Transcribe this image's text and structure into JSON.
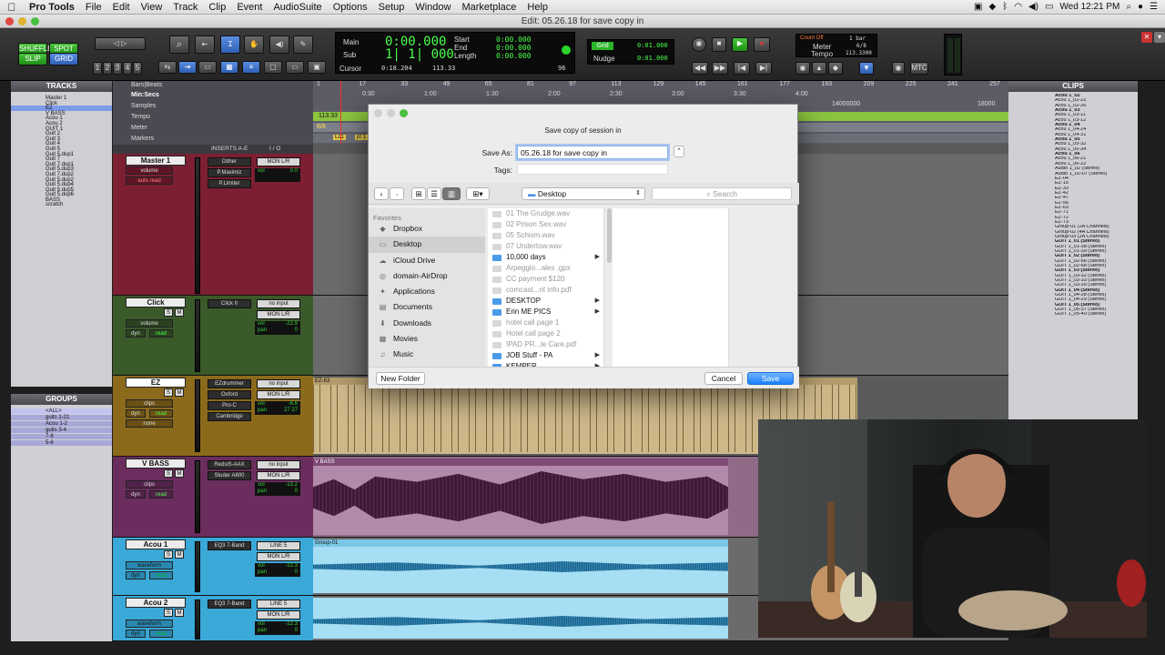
{
  "menubar": {
    "app": "Pro Tools",
    "items": [
      "File",
      "Edit",
      "View",
      "Track",
      "Clip",
      "Event",
      "AudioSuite",
      "Options",
      "Setup",
      "Window",
      "Marketplace",
      "Help"
    ],
    "clock": "Wed 12:21 PM"
  },
  "window": {
    "title": "Edit: 05.26.18 for save copy in"
  },
  "toolbar": {
    "shuffle": "SHUFFLE",
    "spot": "SPOT",
    "slip": "SLIP",
    "grid": "GRID",
    "zoom_presets": [
      "1",
      "2",
      "3",
      "4",
      "5"
    ],
    "counter": {
      "main_label": "Main",
      "main_value": "0:00.000",
      "sub_label": "Sub",
      "sub_value": "1| 1| 000",
      "start_label": "Start",
      "start_value": "0:00.000",
      "end_label": "End",
      "end_value": "0:00.000",
      "length_label": "Length",
      "length_value": "0:00.000",
      "cursor_label": "Cursor",
      "cursor_value": "0:18.204",
      "cursor_tempo": "113.33",
      "cursor_bar": "96"
    },
    "grid_label": "Grid",
    "grid_value": "0:01.000",
    "nudge_label": "Nudge",
    "nudge_value": "0:01.000",
    "count_off": "Count Off",
    "count_off_value": "1 bar",
    "meter_label": "Meter",
    "meter_value": "6/8",
    "tempo_label": "Tempo",
    "tempo_value": "113.3300",
    "mtc": "MTC"
  },
  "tracks_panel": {
    "title": "TRACKS",
    "items": [
      "Master 1",
      "Click",
      "EZ",
      "V BASS",
      "Acou 1",
      "Acou 2",
      "GUIT 1",
      "Guit 2",
      "Guit 3",
      "Guit 4",
      "Guit 5",
      "Guit 5.dup1",
      "Guit 7",
      "Guit 7.dup1",
      "Guit 5.dup3",
      "Guit 7.dup2",
      "Guit 5.dup2",
      "Guit 5.dup4",
      "Guit 5.dup5",
      "Guit 5.dup6",
      "BASS",
      "scratch"
    ]
  },
  "groups_panel": {
    "title": "GROUPS",
    "items": [
      "<ALL>",
      "guits 1-21",
      "Acou 1-2",
      "guits 3-4",
      "7-8",
      "5-6"
    ]
  },
  "rulers": {
    "labels": [
      "Bars|Beats",
      "Min:Secs",
      "Samples",
      "Tempo",
      "Meter",
      "Markers"
    ],
    "bars": [
      "1",
      "17",
      "33",
      "49",
      "65",
      "81",
      "97",
      "113",
      "129",
      "145",
      "161",
      "177",
      "193",
      "209",
      "225",
      "241",
      "257"
    ],
    "mins": [
      "0:30",
      "1:00",
      "1:30",
      "2:00",
      "2:30",
      "3:00",
      "3:30",
      "4:00"
    ],
    "samples": [
      "14000000",
      "18000"
    ],
    "tempo_value": "113.33",
    "meter_value": "6/8",
    "marker_labels": [
      "Lo1",
      "pt 1"
    ]
  },
  "edit_window": {
    "inserts_header": "INSERTS A-E",
    "io_header": "I / O",
    "tracks": [
      {
        "name": "Master 1",
        "view": "volume",
        "automation": "auto read",
        "inserts": [
          "Dither",
          "P.Maximiz",
          "P.Limiter"
        ],
        "io_out": "MON L/R",
        "vol_label": "vol",
        "vol_value": "0.0"
      },
      {
        "name": "Click",
        "view": "volume",
        "automation": "read",
        "mode": "dyn",
        "inserts": [
          "Click II"
        ],
        "io_in": "no input",
        "io_out": "MON L/R",
        "vol_label": "vol",
        "vol_value": "-22.9",
        "pan_label": "pan",
        "pan_value": "0"
      },
      {
        "name": "EZ",
        "view": "clips",
        "automation": "read",
        "mode": "dyn",
        "extra": "none",
        "inserts": [
          "EZdrummer",
          "Oxford",
          "Pro-C",
          "Cambridge"
        ],
        "io_in": "no input",
        "io_out": "MON L/R",
        "vol_label": "vol",
        "vol_value": "-6.6",
        "pan_label": "pan",
        "pan_value": "27 27",
        "clip": "EZ-63"
      },
      {
        "name": "V BASS",
        "view": "clips",
        "automation": "read",
        "mode": "dyn",
        "inserts": [
          "RedsiS-AAX",
          "Studer A800"
        ],
        "io_in": "no input",
        "io_out": "MON L/R",
        "vol_label": "vol",
        "vol_value": "-13.2",
        "pan_label": "pan",
        "pan_value": "0",
        "clip": "V BASS"
      },
      {
        "name": "Acou 1",
        "view": "waveform",
        "automation": "read",
        "mode": "dyn",
        "inserts": [
          "EQ3 7-Band"
        ],
        "io_in": "LINE 5",
        "io_out": "MON L/R",
        "vol_label": "vol",
        "vol_value": "-12.3",
        "pan_label": "pan",
        "pan_value": "0",
        "clip": "Group-01"
      },
      {
        "name": "Acou 2",
        "view": "waveform",
        "automation": "read",
        "mode": "dyn",
        "inserts": [
          "EQ3 7-Band"
        ],
        "io_in": "LINE 5",
        "io_out": "MON L/R",
        "vol_label": "vol",
        "vol_value": "-12.3",
        "pan_label": "pan",
        "pan_value": "0"
      }
    ],
    "track_buttons": {
      "solo": "S",
      "mute": "M"
    }
  },
  "clips_panel": {
    "title": "CLIPS",
    "items": [
      "Acou 1_02",
      "Acou 1_02-22",
      "Acou 1_02-26",
      "Acou 1_03",
      "Acou 1_03-11",
      "Acou 1_03-12",
      "Acou 1_04",
      "Acou 1_04-24",
      "Acou 1_04-31",
      "Acou 1_05",
      "Acou 1_05-32",
      "Acou 1_05-34",
      "Acou 1_06",
      "Acou 1_06-21",
      "Acou 1_06-22",
      "Audio 1_02 (Stereo)",
      "Audio 1_02-07 (Stereo)",
      "EZ-04",
      "EZ-15",
      "EZ-33",
      "EZ-42",
      "EZ-47",
      "EZ-56",
      "EZ-63",
      "EZ-71",
      "EZ-72",
      "EZ-73",
      "Group-01 (2A Channels)",
      "Group-02 (4A Channels)",
      "Group-03 (2A Channels)",
      "GUIT 1_01 (Stereo)",
      "GUIT 1_01-38 (Stereo)",
      "GUIT 1_01-39 (Stereo)",
      "GUIT 1_02 (Stereo)",
      "GUIT 1_02-66 (Stereo)",
      "GUIT 1_02-68 (Stereo)",
      "GUIT 1_03 (Stereo)",
      "GUIT 1_03-32 (Stereo)",
      "GUIT 1_03-33 (Stereo)",
      "GUIT 1_03-39 (Stereo)",
      "GUIT 1_04 (Stereo)",
      "GUIT 1_04-28 (Stereo)",
      "GUIT 1_04-29 (Stereo)",
      "GUIT 1_05 (Stereo)",
      "GUIT 1_05-37 (Stereo)",
      "GUIT 1_05-40 (Stereo)"
    ]
  },
  "dialog": {
    "title": "Save copy of session in",
    "save_as_label": "Save As:",
    "save_as_value": "05.26.18 for save copy in",
    "tags_label": "Tags:",
    "location": "Desktop",
    "search_placeholder": "Search",
    "favorites_header": "Favorites",
    "favorites": [
      {
        "label": "Dropbox",
        "icon": "dropbox-icon",
        "glyph": "◆"
      },
      {
        "label": "Desktop",
        "icon": "desktop-folder-icon",
        "glyph": "▭"
      },
      {
        "label": "iCloud Drive",
        "icon": "cloud-icon",
        "glyph": "☁"
      },
      {
        "label": "domain-AirDrop",
        "icon": "airdrop-icon",
        "glyph": "◎"
      },
      {
        "label": "Applications",
        "icon": "applications-icon",
        "glyph": "✦"
      },
      {
        "label": "Documents",
        "icon": "documents-icon",
        "glyph": "▤"
      },
      {
        "label": "Downloads",
        "icon": "downloads-icon",
        "glyph": "⬇"
      },
      {
        "label": "Movies",
        "icon": "movies-icon",
        "glyph": "▦"
      },
      {
        "label": "Music",
        "icon": "music-icon",
        "glyph": "♫"
      }
    ],
    "files": [
      {
        "name": "01 The Grudge.wav",
        "enabled": false,
        "folder": false
      },
      {
        "name": "02 Prison Sex.wav",
        "enabled": false,
        "folder": false
      },
      {
        "name": "05 Schism.wav",
        "enabled": false,
        "folder": false
      },
      {
        "name": "07 Undertow.wav",
        "enabled": false,
        "folder": false
      },
      {
        "name": "10,000 days",
        "enabled": true,
        "folder": true
      },
      {
        "name": "Arpeggio...ales .gpx",
        "enabled": false,
        "folder": false
      },
      {
        "name": "CC payment $120",
        "enabled": false,
        "folder": false
      },
      {
        "name": "comcast...nt info.pdf",
        "enabled": false,
        "folder": false
      },
      {
        "name": "DESKTOP",
        "enabled": true,
        "folder": true
      },
      {
        "name": "Erin ME PICS",
        "enabled": true,
        "folder": true
      },
      {
        "name": "hotel call page 1",
        "enabled": false,
        "folder": false
      },
      {
        "name": "Hotel call page 2",
        "enabled": false,
        "folder": false
      },
      {
        "name": "IPAD PR...le Care.pdf",
        "enabled": false,
        "folder": false
      },
      {
        "name": "JOB Stuff - PA",
        "enabled": true,
        "folder": true
      },
      {
        "name": "KEMPER",
        "enabled": true,
        "folder": true
      }
    ],
    "new_folder": "New Folder",
    "cancel": "Cancel",
    "save": "Save"
  },
  "colors": {
    "accent": "#1a82fb",
    "master_track": "#7c1f33",
    "click_track": "#3a5a2a",
    "ez_track": "#8b6a1c",
    "vbass_track": "#6b2d5d",
    "acou_track": "#3aa9d8"
  }
}
